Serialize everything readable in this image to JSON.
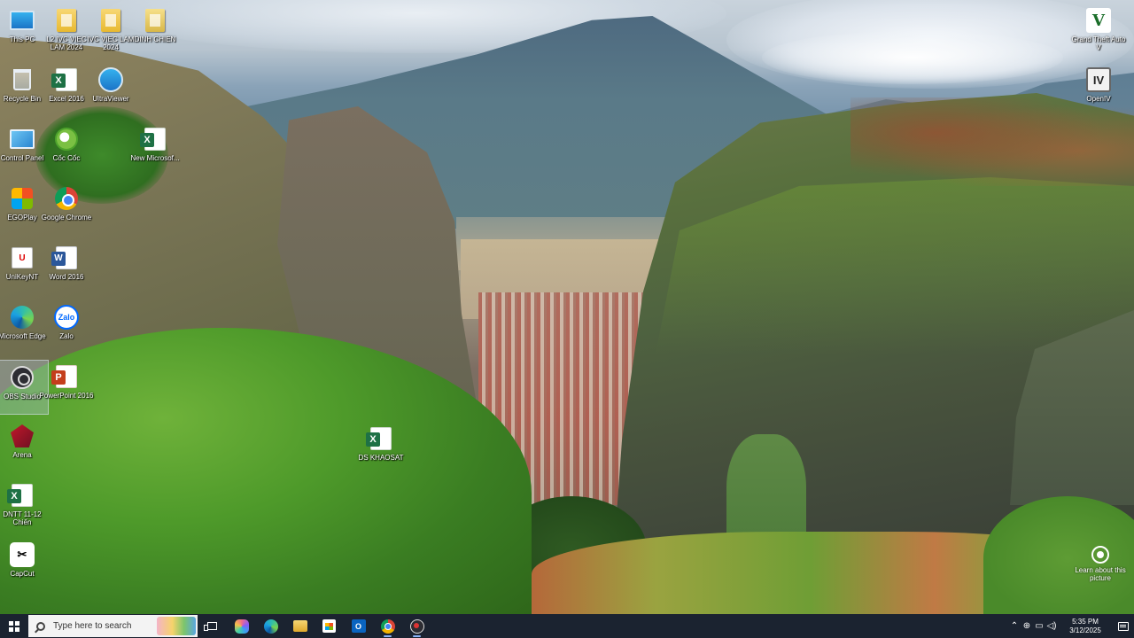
{
  "desktop": {
    "icons": [
      {
        "id": "this-pc",
        "label": "This PC",
        "icon": "monitor-icon"
      },
      {
        "id": "l2-ivc",
        "label": "L2 IVC VIEC LAM 2024",
        "icon": "folder-icon"
      },
      {
        "id": "ivc",
        "label": "IVC VIEC LAM 2024",
        "icon": "folder-icon"
      },
      {
        "id": "dinh-chien",
        "label": "DINH CHIEN",
        "icon": "folder-icon"
      },
      {
        "id": "recycle-bin",
        "label": "Recycle Bin",
        "icon": "recycle-bin-icon"
      },
      {
        "id": "excel-2016",
        "label": "Excel 2016",
        "icon": "excel-icon"
      },
      {
        "id": "ultraviewer",
        "label": "UltraViewer",
        "icon": "ultraviewer-icon"
      },
      {
        "id": "control-panel",
        "label": "Control Panel",
        "icon": "control-panel-icon"
      },
      {
        "id": "coc-coc",
        "label": "Cốc Cốc",
        "icon": "coccoc-icon"
      },
      {
        "id": "new-excel",
        "label": "New Microsof...",
        "icon": "excel-icon"
      },
      {
        "id": "egoplay",
        "label": "EGOPlay",
        "icon": "gaming-icon"
      },
      {
        "id": "google-chrome",
        "label": "Google Chrome",
        "icon": "chrome-icon"
      },
      {
        "id": "unikey",
        "label": "UniKeyNT",
        "icon": "unikey-icon"
      },
      {
        "id": "word-2016",
        "label": "Word 2016",
        "icon": "word-icon"
      },
      {
        "id": "microsoft-edge",
        "label": "Microsoft Edge",
        "icon": "edge-icon"
      },
      {
        "id": "zalo",
        "label": "Zalo",
        "icon": "zalo-icon"
      },
      {
        "id": "obs-studio",
        "label": "OBS Studio",
        "icon": "obs-icon"
      },
      {
        "id": "powerpoint-2016",
        "label": "PowerPoint 2016",
        "icon": "powerpoint-icon"
      },
      {
        "id": "arena",
        "label": "Arena",
        "icon": "arena-icon"
      },
      {
        "id": "ds-khaosat",
        "label": "DS KHAOSAT",
        "icon": "excel-icon"
      },
      {
        "id": "dntt-chien",
        "label": "DNTT 11-12 Chiến",
        "icon": "excel-icon"
      },
      {
        "id": "capcut",
        "label": "CapCut",
        "icon": "capcut-icon"
      },
      {
        "id": "gta-v",
        "label": "Grand Theft Auto V",
        "icon": "gta-icon"
      },
      {
        "id": "openiv",
        "label": "OpenIV",
        "icon": "openiv-icon"
      }
    ],
    "learn_about": "Learn about this picture"
  },
  "taskbar": {
    "search_placeholder": "Type here to search",
    "apps": [
      "task-view",
      "copilot",
      "edge",
      "file-explorer",
      "microsoft-store",
      "outlook",
      "chrome",
      "obs-studio"
    ],
    "outlook_glyph": "O",
    "clock_time": "5:35 PM",
    "clock_date": "3/12/2025",
    "accent": "#1b2330"
  }
}
